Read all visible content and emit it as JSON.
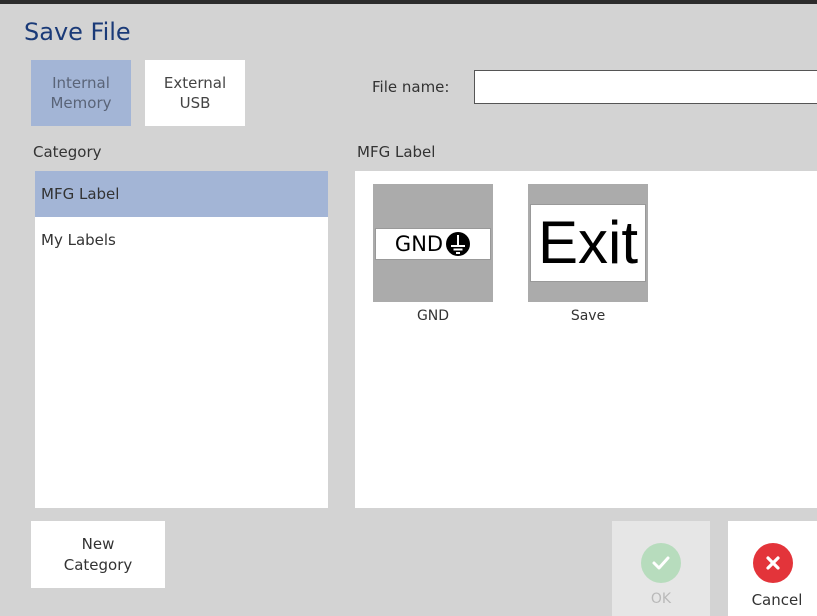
{
  "window": {
    "title": "Save File"
  },
  "source": {
    "internal_label": "Internal\nMemory",
    "external_label": "External\nUSB",
    "selected": "internal"
  },
  "file_name": {
    "label": "File name:",
    "value": "",
    "placeholder": ""
  },
  "category": {
    "heading": "Category",
    "items": [
      {
        "label": "MFG Label",
        "selected": true
      },
      {
        "label": "My Labels",
        "selected": false
      }
    ]
  },
  "files": {
    "heading": "MFG Label",
    "items": [
      {
        "caption": "GND",
        "preview_text": "GND",
        "preview_icon": "ground-symbol-icon"
      },
      {
        "caption": "Save",
        "preview_text": "Exit"
      }
    ]
  },
  "actions": {
    "new_category_label": "New\nCategory",
    "ok_label": "OK",
    "ok_enabled": false,
    "cancel_label": "Cancel"
  },
  "colors": {
    "title": "#1a3a78",
    "selected": "#a3b5d6",
    "background": "#d3d3d3",
    "ok_green": "#b7dcbd",
    "cancel_red": "#e3343a"
  }
}
